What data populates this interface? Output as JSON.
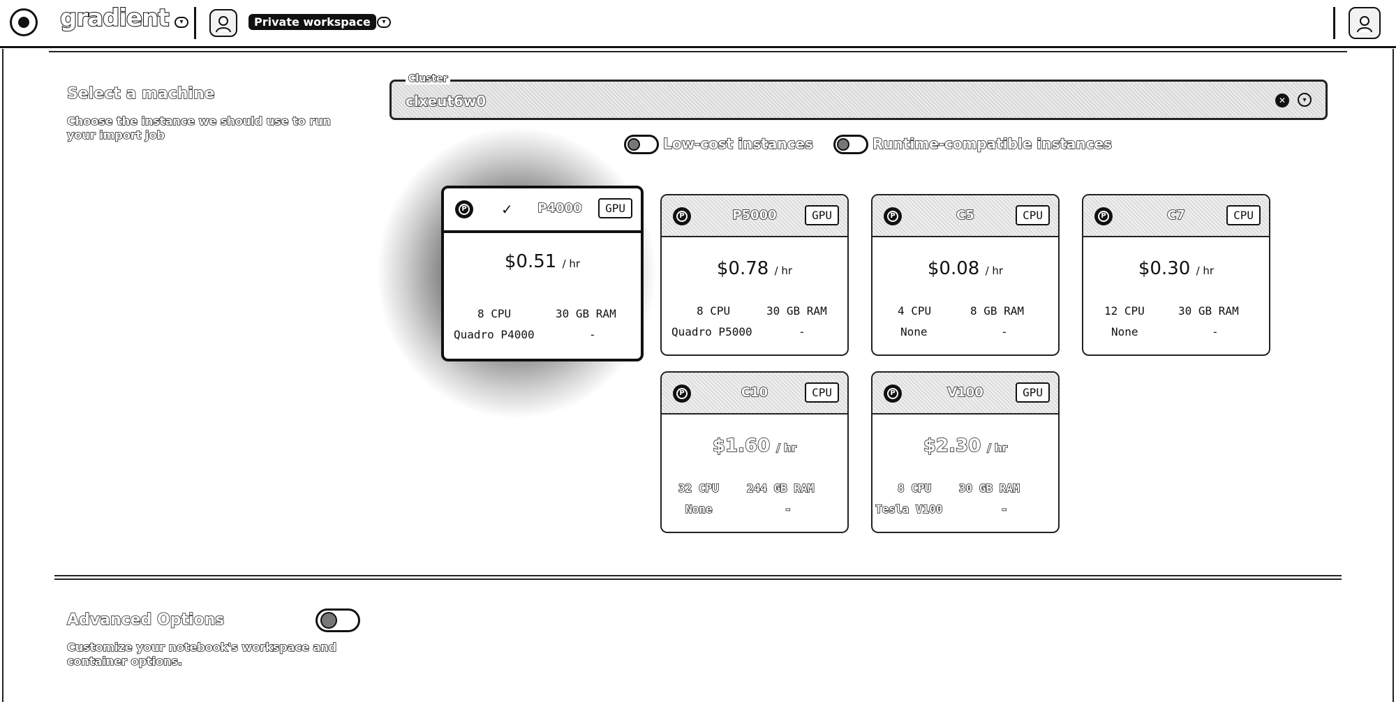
{
  "header": {
    "brand": "gradient",
    "workspace": "Private workspace"
  },
  "machine_section": {
    "title": "Select a machine",
    "description": "Choose the instance we should use to run your import job"
  },
  "cluster": {
    "legend": "Cluster",
    "value": "clxeut6w0"
  },
  "toggles": {
    "low_cost": "Low-cost instances",
    "runtime_compatible": "Runtime-compatible instances"
  },
  "machines": [
    {
      "name": "P4000",
      "type": "GPU",
      "price": "$0.51",
      "unit": "/ hr",
      "cpu": "8 CPU",
      "ram": "30 GB RAM",
      "gpu": "Quadro P4000",
      "extra": "-",
      "selected": true
    },
    {
      "name": "P5000",
      "type": "GPU",
      "price": "$0.78",
      "unit": "/ hr",
      "cpu": "8 CPU",
      "ram": "30 GB RAM",
      "gpu": "Quadro P5000",
      "extra": "-",
      "selected": false
    },
    {
      "name": "C5",
      "type": "CPU",
      "price": "$0.08",
      "unit": "/ hr",
      "cpu": "4 CPU",
      "ram": "8 GB RAM",
      "gpu": "None",
      "extra": "-",
      "selected": false
    },
    {
      "name": "C7",
      "type": "CPU",
      "price": "$0.30",
      "unit": "/ hr",
      "cpu": "12 CPU",
      "ram": "30 GB RAM",
      "gpu": "None",
      "extra": "-",
      "selected": false
    },
    {
      "name": "C10",
      "type": "CPU",
      "price": "$1.60",
      "unit": "/ hr",
      "cpu": "32 CPU",
      "ram": "244 GB RAM",
      "gpu": "None",
      "extra": "-",
      "selected": false
    },
    {
      "name": "V100",
      "type": "GPU",
      "price": "$2.30",
      "unit": "/ hr",
      "cpu": "8 CPU",
      "ram": "30 GB RAM",
      "gpu": "Tesla V100",
      "extra": "-",
      "selected": false
    }
  ],
  "advanced": {
    "title": "Advanced Options",
    "description": "Customize your notebook's workspace and container options."
  }
}
